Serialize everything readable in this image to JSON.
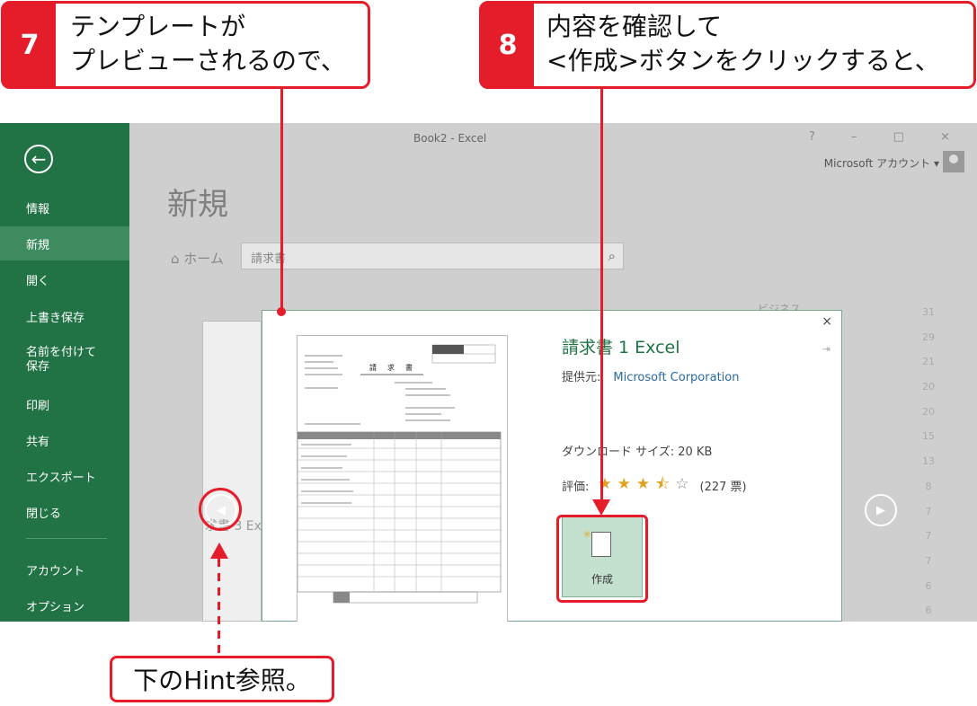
{
  "callout7": {
    "num": "7",
    "line1": "テンプレートが",
    "line2": "プレビューされるので、"
  },
  "callout8": {
    "num": "8",
    "line1": "内容を確認して",
    "line2": "<作成>ボタンをクリックすると、"
  },
  "window": {
    "title": "Book2 - Excel",
    "controls": "? – □ ×",
    "account_label": "Microsoft アカウント ▾"
  },
  "sidebar": {
    "back": "←",
    "items": [
      {
        "label": "情報"
      },
      {
        "label": "新規"
      },
      {
        "label": "開く"
      },
      {
        "label": "上書き保存"
      },
      {
        "label": "名前を付けて\n保存",
        "l1": "名前を付けて",
        "l2": "保存"
      },
      {
        "label": "印刷"
      },
      {
        "label": "共有"
      },
      {
        "label": "エクスポート"
      },
      {
        "label": "閉じる"
      },
      {
        "label": "アカウント"
      },
      {
        "label": "オプション"
      }
    ]
  },
  "main": {
    "heading": "新規",
    "home": "⌂ ホーム",
    "search_value": "請求書",
    "category": "ビジネス",
    "bg_thumb_title": "求書 3 Ex",
    "counts": [
      "31",
      "29",
      "21",
      "20",
      "20",
      "15",
      "13",
      "8",
      "7",
      "7",
      "7",
      "6",
      "6"
    ]
  },
  "dialog": {
    "close": "×",
    "title": "請求書 1 Excel",
    "pin": "⇥",
    "provider_label": "提供元:",
    "provider_value": "Microsoft Corporation",
    "download_size": "ダウンロード サイズ: 20 KB",
    "rating_label": "評価:",
    "rating_stars": 3.5,
    "rating_max": 5,
    "votes": "(227 票)",
    "create_label": "作成",
    "doc_title": "請　求　書"
  },
  "hint": {
    "text": "下のHint参照。"
  },
  "colors": {
    "accent": "#e51d2a",
    "excel_green": "#217346",
    "create_tile": "#c4e0cf"
  }
}
